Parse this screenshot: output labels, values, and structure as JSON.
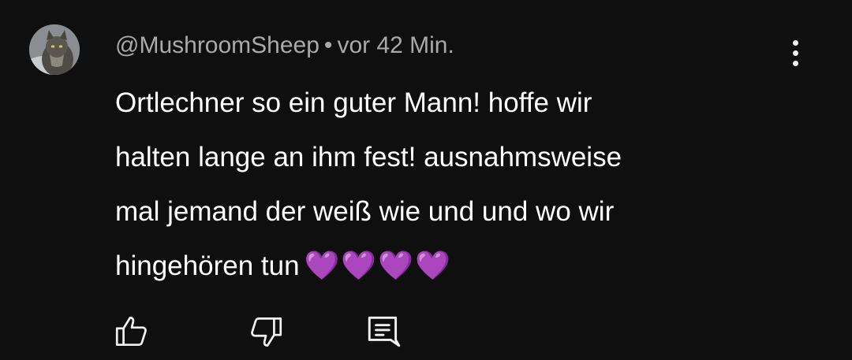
{
  "comment": {
    "author": "@MushroomSheep",
    "separator": "•",
    "timestamp": "vor 42 Min.",
    "text": "Ortlechner so ein guter Mann! hoffe wir\nhalten lange an ihm fest! ausnahmsweise\nmal jemand der weiß wie und und wo wir\nhingehören tun",
    "emojis": "💜💜💜💜"
  },
  "icons": {
    "avatar": "cat-avatar",
    "menu": "more-vertical-icon",
    "like": "thumbs-up-icon",
    "dislike": "thumbs-down-icon",
    "reply": "reply-comment-icon"
  },
  "colors": {
    "background": "#0f0f0f",
    "text": "#ffffff",
    "meta": "#aaaaaa",
    "heart": "#a149e2"
  }
}
